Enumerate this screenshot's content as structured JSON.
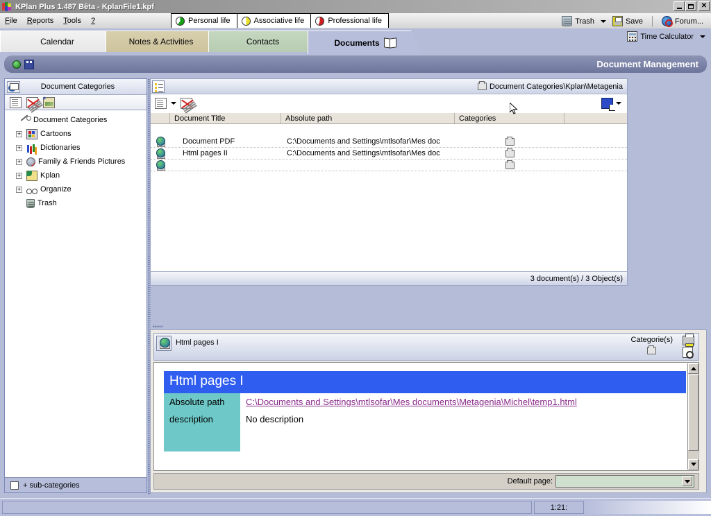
{
  "window": {
    "title": "KPlan Plus 1.487 Bêta - KplanFile1.kpf",
    "minimize": "_",
    "maximize": "□",
    "close": "✕"
  },
  "menu": {
    "items": [
      {
        "label": "File"
      },
      {
        "label": "Reports"
      },
      {
        "label": "Tools"
      },
      {
        "label": "?"
      }
    ]
  },
  "life_tabs": [
    {
      "label": "Personal life",
      "icon": "pie-green-icon"
    },
    {
      "label": "Associative life",
      "icon": "pie-yellow-icon"
    },
    {
      "label": "Professional life",
      "icon": "pie-red-icon"
    }
  ],
  "top_tools": {
    "trash": "Trash",
    "save": "Save",
    "forum": "Forum...",
    "time_calculator": "Time Calculator"
  },
  "main_tabs": [
    {
      "label": "Calendar",
      "active": false
    },
    {
      "label": "Notes & Activities",
      "active": false
    },
    {
      "label": "Contacts",
      "active": false
    },
    {
      "label": "Documents",
      "active": true
    }
  ],
  "banner": {
    "title": "Document Management"
  },
  "sidebar": {
    "header": "Document Categories",
    "toolbar_icons": [
      "new-document-icon",
      "delete-document-icon",
      "new-image-icon"
    ],
    "root": "Document Categories",
    "items": [
      {
        "label": "Cartoons",
        "expandable": true,
        "icon": "cartoons-icon"
      },
      {
        "label": "Dictionaries",
        "expandable": true,
        "icon": "dictionaries-icon"
      },
      {
        "label": "Family & Friends Pictures",
        "expandable": true,
        "icon": "family-pictures-icon"
      },
      {
        "label": "Kplan",
        "expandable": true,
        "icon": "kplan-icon"
      },
      {
        "label": "Organize",
        "expandable": true,
        "icon": "organize-icon"
      },
      {
        "label": "Trash",
        "expandable": false,
        "icon": "trash-icon"
      }
    ],
    "subcategories_label": "+ sub-categories",
    "subcategories_checked": false
  },
  "list_pane": {
    "path": "Document Categories\\Kplan\\Metagenia",
    "columns": [
      "",
      "Document Title",
      "Absolute path",
      "Categories",
      ""
    ],
    "rows": [
      {
        "title": "Document PDF",
        "path": "C:\\Documents and Settings\\mtlsofar\\Mes doc",
        "category_icon": "folder-icon"
      },
      {
        "title": "Html pages II",
        "path": "C:\\Documents and Settings\\mtlsofar\\Mes doc",
        "category_icon": "folder-icon"
      },
      {
        "title": "",
        "path": "",
        "category_icon": "folder-icon"
      }
    ],
    "status": "3 document(s) / 3 Object(s)"
  },
  "detail_pane": {
    "header_title": "Html pages I",
    "categories_label": "Categorie(s)",
    "document": {
      "title": "Html pages I",
      "fields": [
        {
          "label": "Absolute path",
          "value": "C:\\Documents and Settings\\mtlsofar\\Mes documents\\Metagenia\\Michel\\temp1.html",
          "is_link": true
        },
        {
          "label": "description",
          "value": "No description",
          "is_link": false
        }
      ]
    },
    "default_page_label": "Default page:",
    "default_page_value": ""
  },
  "statusbar": {
    "message": "",
    "time": "1:21:"
  },
  "colors": {
    "banner": "#7c84a8",
    "tab_active": "#b7bedb",
    "tab_notes": "#cdc39c",
    "tab_contacts": "#b7ccb2",
    "doc_title_bg": "#2f5df0",
    "doc_label_bg": "#6ec8c8",
    "link": "#8a2a8a",
    "combo_bg": "#cfe0cf"
  }
}
